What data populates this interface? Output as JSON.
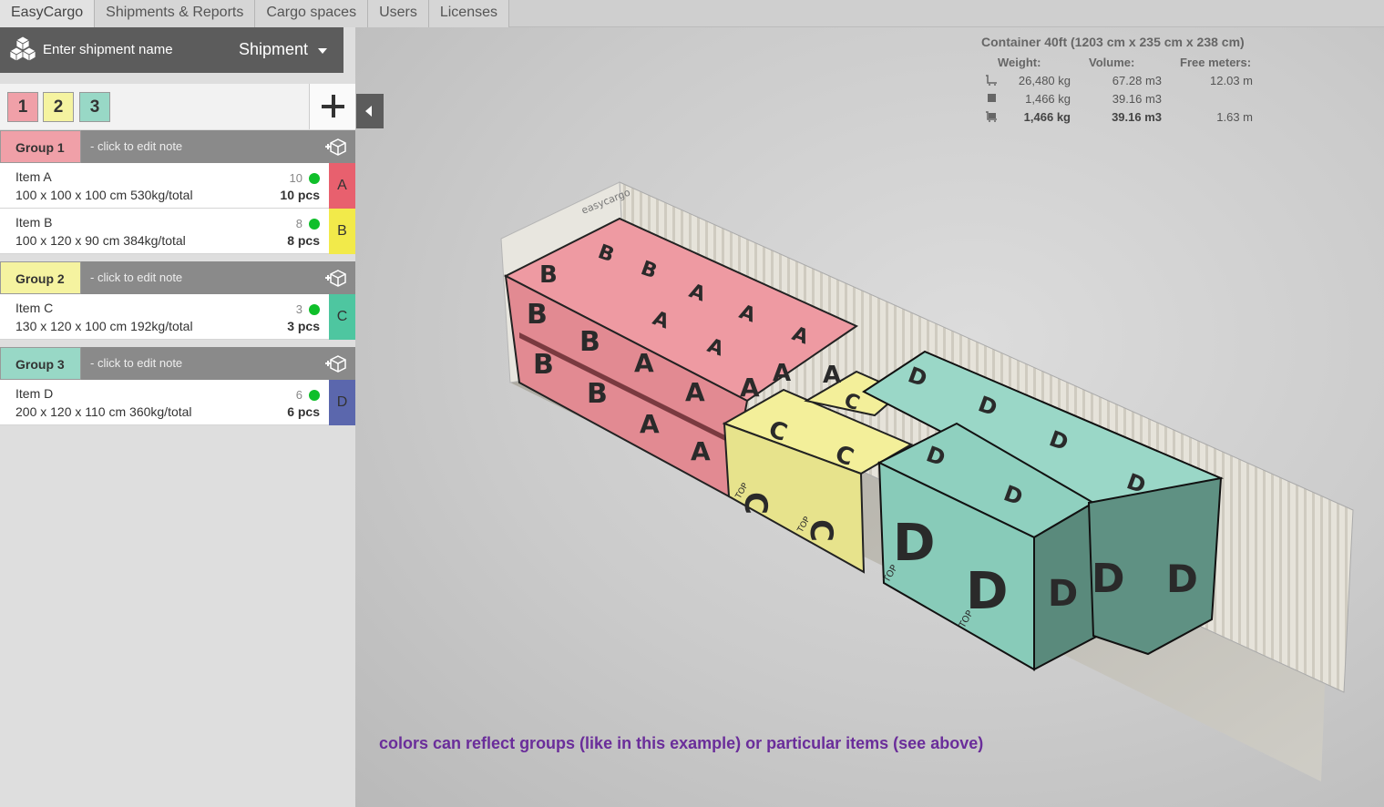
{
  "nav": {
    "tabs": [
      "EasyCargo",
      "Shipments & Reports",
      "Cargo spaces",
      "Users",
      "Licenses"
    ]
  },
  "shipment": {
    "placeholder": "Enter shipment name",
    "type": "Shipment"
  },
  "group_tabs": [
    "1",
    "2",
    "3"
  ],
  "groups": [
    {
      "label": "Group 1",
      "note": "- click to edit note",
      "color": "#f0a0a8",
      "items": [
        {
          "name": "Item A",
          "dims": "100 x 100 x 100 cm 530kg/total",
          "count": "10",
          "pcs": "10 pcs",
          "badge": "A",
          "badge_color": "#e8606e"
        },
        {
          "name": "Item B",
          "dims": "100 x 120 x 90 cm 384kg/total",
          "count": "8",
          "pcs": "8 pcs",
          "badge": "B",
          "badge_color": "#f2ea4a"
        }
      ]
    },
    {
      "label": "Group 2",
      "note": "- click to edit note",
      "color": "#f5f3a0",
      "items": [
        {
          "name": "Item C",
          "dims": "130 x 120 x 100 cm 192kg/total",
          "count": "3",
          "pcs": "3 pcs",
          "badge": "C",
          "badge_color": "#4ec6a0"
        }
      ]
    },
    {
      "label": "Group 3",
      "note": "- click to edit note",
      "color": "#98d8c6",
      "items": [
        {
          "name": "Item D",
          "dims": "200 x 120 x 110 cm 360kg/total",
          "count": "6",
          "pcs": "6 pcs",
          "badge": "D",
          "badge_color": "#5b67ad"
        }
      ]
    }
  ],
  "container": {
    "title": "Container 40ft (1203 cm x 235 cm x 238 cm)",
    "headers": {
      "weight": "Weight:",
      "volume": "Volume:",
      "free": "Free meters:"
    },
    "rows": [
      {
        "icon": "cart-empty-icon",
        "weight": "26,480 kg",
        "volume": "67.28 m3",
        "free": "12.03 m"
      },
      {
        "icon": "box-icon",
        "weight": "1,466 kg",
        "volume": "39.16 m3",
        "free": ""
      },
      {
        "icon": "cart-full-icon",
        "weight": "1,466 kg",
        "volume": "39.16 m3",
        "free": "1.63 m"
      }
    ]
  },
  "scene": {
    "brand": "easycargo",
    "letters": [
      "A",
      "B",
      "C",
      "D"
    ],
    "top_label": "TOP"
  },
  "caption": "colors can reflect groups (like in this example) or particular  items (see above)"
}
